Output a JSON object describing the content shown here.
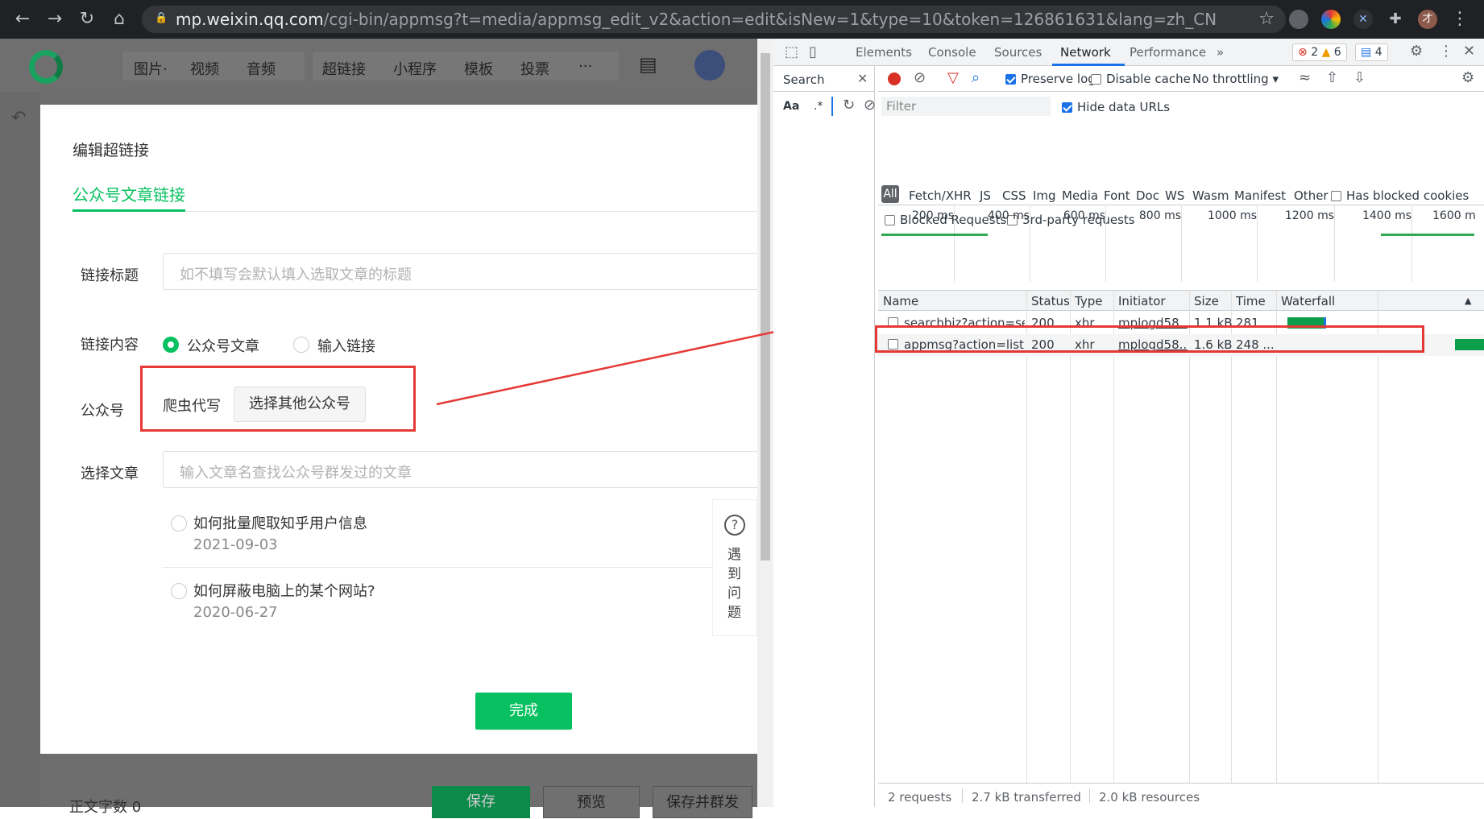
{
  "browser": {
    "url_host": "mp.weixin.qq.com",
    "url_path": "/cgi-bin/appmsg?t=media/appmsg_edit_v2&action=edit&isNew=1&type=10&token=126861631&lang=zh_CN",
    "profile_initial": "才"
  },
  "app": {
    "toolbar": [
      "图片·",
      "视频",
      "音频",
      "超链接",
      "小程序",
      "模板",
      "投票",
      "···"
    ],
    "dialog": {
      "title": "编辑超链接",
      "tab": "公众号文章链接",
      "link_title_label": "链接标题",
      "link_title_placeholder": "如不填写会默认填入选取文章的标题",
      "link_content_label": "链接内容",
      "option_article": "公众号文章",
      "option_link": "输入链接",
      "account_label": "公众号",
      "account_name": "爬虫代写",
      "choose_account_button": "选择其他公众号",
      "select_article_label": "选择文章",
      "select_article_placeholder": "输入文章名查找公众号群发过的文章",
      "articles": [
        {
          "title": "如何批量爬取知乎用户信息",
          "date": "2021-09-03"
        },
        {
          "title": "如何屏蔽电脑上的某个网站?",
          "date": "2020-06-27"
        }
      ],
      "help_text": "遇到问题",
      "done_button": "完成"
    },
    "bottom": {
      "word_count": "正文字数 0",
      "save": "保存",
      "preview": "预览",
      "save_send": "保存并群发"
    }
  },
  "devtools": {
    "tabs": [
      "Elements",
      "Console",
      "Sources",
      "Network",
      "Performance",
      "»"
    ],
    "errors": "2",
    "warnings": "6",
    "messages": "4",
    "search_label": "Search",
    "preserve_log": "Preserve log",
    "disable_cache": "Disable cache",
    "throttling": "No throttling",
    "filter_placeholder": "Filter",
    "hide_data_urls": "Hide data URLs",
    "type_filters": [
      "All",
      "Fetch/XHR",
      "JS",
      "CSS",
      "Img",
      "Media",
      "Font",
      "Doc",
      "WS",
      "Wasm",
      "Manifest",
      "Other"
    ],
    "has_blocked_cookies": "Has blocked cookies",
    "blocked_requests": "Blocked Requests",
    "third_party": "3rd-party requests",
    "timeline_ticks": [
      "200 ms",
      "400 ms",
      "600 ms",
      "800 ms",
      "1000 ms",
      "1200 ms",
      "1400 ms",
      "1600 m"
    ],
    "columns": [
      "Name",
      "Status",
      "Type",
      "Initiator",
      "Size",
      "Time",
      "Waterfall"
    ],
    "rows": [
      {
        "name": "searchbiz?action=se...",
        "status": "200",
        "type": "xhr",
        "initiator": "mplogd58...",
        "size": "1.1 kB",
        "time": "281 ..."
      },
      {
        "name": "appmsg?action=list...",
        "status": "200",
        "type": "xhr",
        "initiator": "mplogd58...",
        "size": "1.6 kB",
        "time": "248 ..."
      }
    ],
    "status_requests": "2 requests",
    "status_transferred": "2.7 kB transferred",
    "status_resources": "2.0 kB resources"
  },
  "colors": {
    "accent": "#07c160",
    "annotation": "#e53935",
    "devtools_blue": "#1a73e8"
  }
}
